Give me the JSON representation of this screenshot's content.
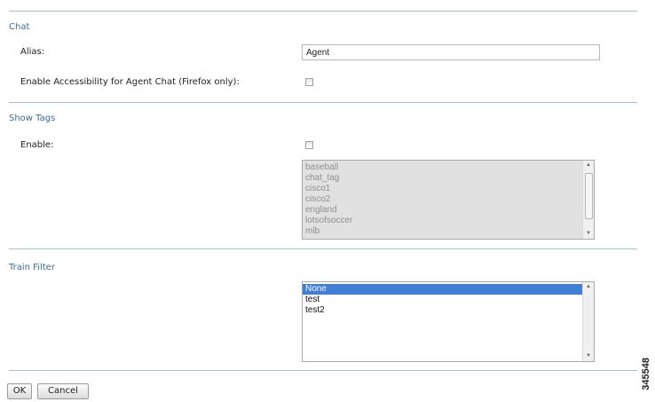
{
  "sections": {
    "chat": {
      "title": "Chat",
      "alias_label": "Alias:",
      "alias_value": "Agent",
      "accessibility_label": "Enable Accessibility for Agent Chat (Firefox only):",
      "accessibility_checked": false
    },
    "show_tags": {
      "title": "Show Tags",
      "enable_label": "Enable:",
      "enable_checked": false,
      "tags": [
        "baseball",
        "chat_tag",
        "cisco1",
        "cisco2",
        "england",
        "lotsofsoccer",
        "mlb"
      ]
    },
    "train_filter": {
      "title": "Train Filter",
      "options": [
        "None",
        "test",
        "test2"
      ],
      "selected": "None"
    }
  },
  "buttons": {
    "ok_label": "OK",
    "cancel_label": "Cancel"
  },
  "figure_id": "345548",
  "colors": {
    "section_title": "#3d6c95",
    "divider": "#a9bfd3",
    "selection": "#3f7fd5"
  }
}
